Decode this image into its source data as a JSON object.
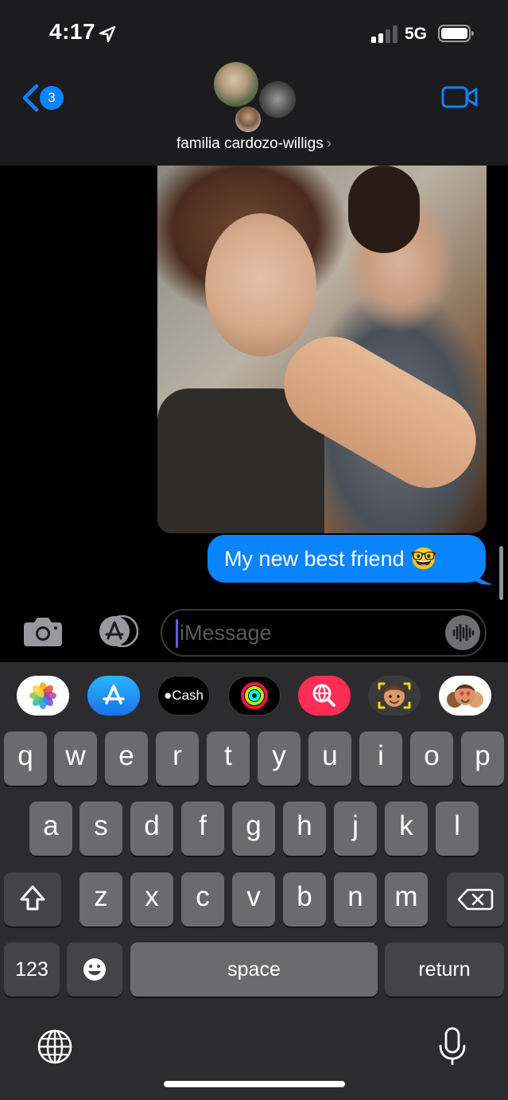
{
  "status_bar": {
    "time": "4:17",
    "network": "5G"
  },
  "nav": {
    "back_count": "3",
    "group_name": "familia cardozo-willigs",
    "chevron": "›"
  },
  "messages": [
    {
      "type": "photo",
      "from": "me"
    },
    {
      "type": "text",
      "from": "me",
      "text": "My new best friend 🤓"
    }
  ],
  "compose": {
    "placeholder": "iMessage"
  },
  "app_strip": [
    {
      "name": "Photos",
      "icon": "photos-icon"
    },
    {
      "name": "App Store",
      "icon": "appstore-icon"
    },
    {
      "name": "Cash",
      "label": "Cash",
      "icon": "apple-cash-icon"
    },
    {
      "name": "Activity",
      "icon": "activity-rings-icon"
    },
    {
      "name": "Images",
      "icon": "image-search-icon"
    },
    {
      "name": "Memoji",
      "icon": "memoji-icon"
    },
    {
      "name": "Memoji Stickers",
      "icon": "memoji-stickers-icon"
    }
  ],
  "keyboard": {
    "row1": [
      "q",
      "w",
      "e",
      "r",
      "t",
      "y",
      "u",
      "i",
      "o",
      "p"
    ],
    "row2": [
      "a",
      "s",
      "d",
      "f",
      "g",
      "h",
      "j",
      "k",
      "l"
    ],
    "row3": [
      "z",
      "x",
      "c",
      "v",
      "b",
      "n",
      "m"
    ],
    "numbers": "123",
    "space": "space",
    "return": "return"
  },
  "colors": {
    "accent": "#0a84ff",
    "keyboard_bg": "#2c2c2e",
    "key": "#6b6b6d",
    "key_dark": "#444447"
  }
}
